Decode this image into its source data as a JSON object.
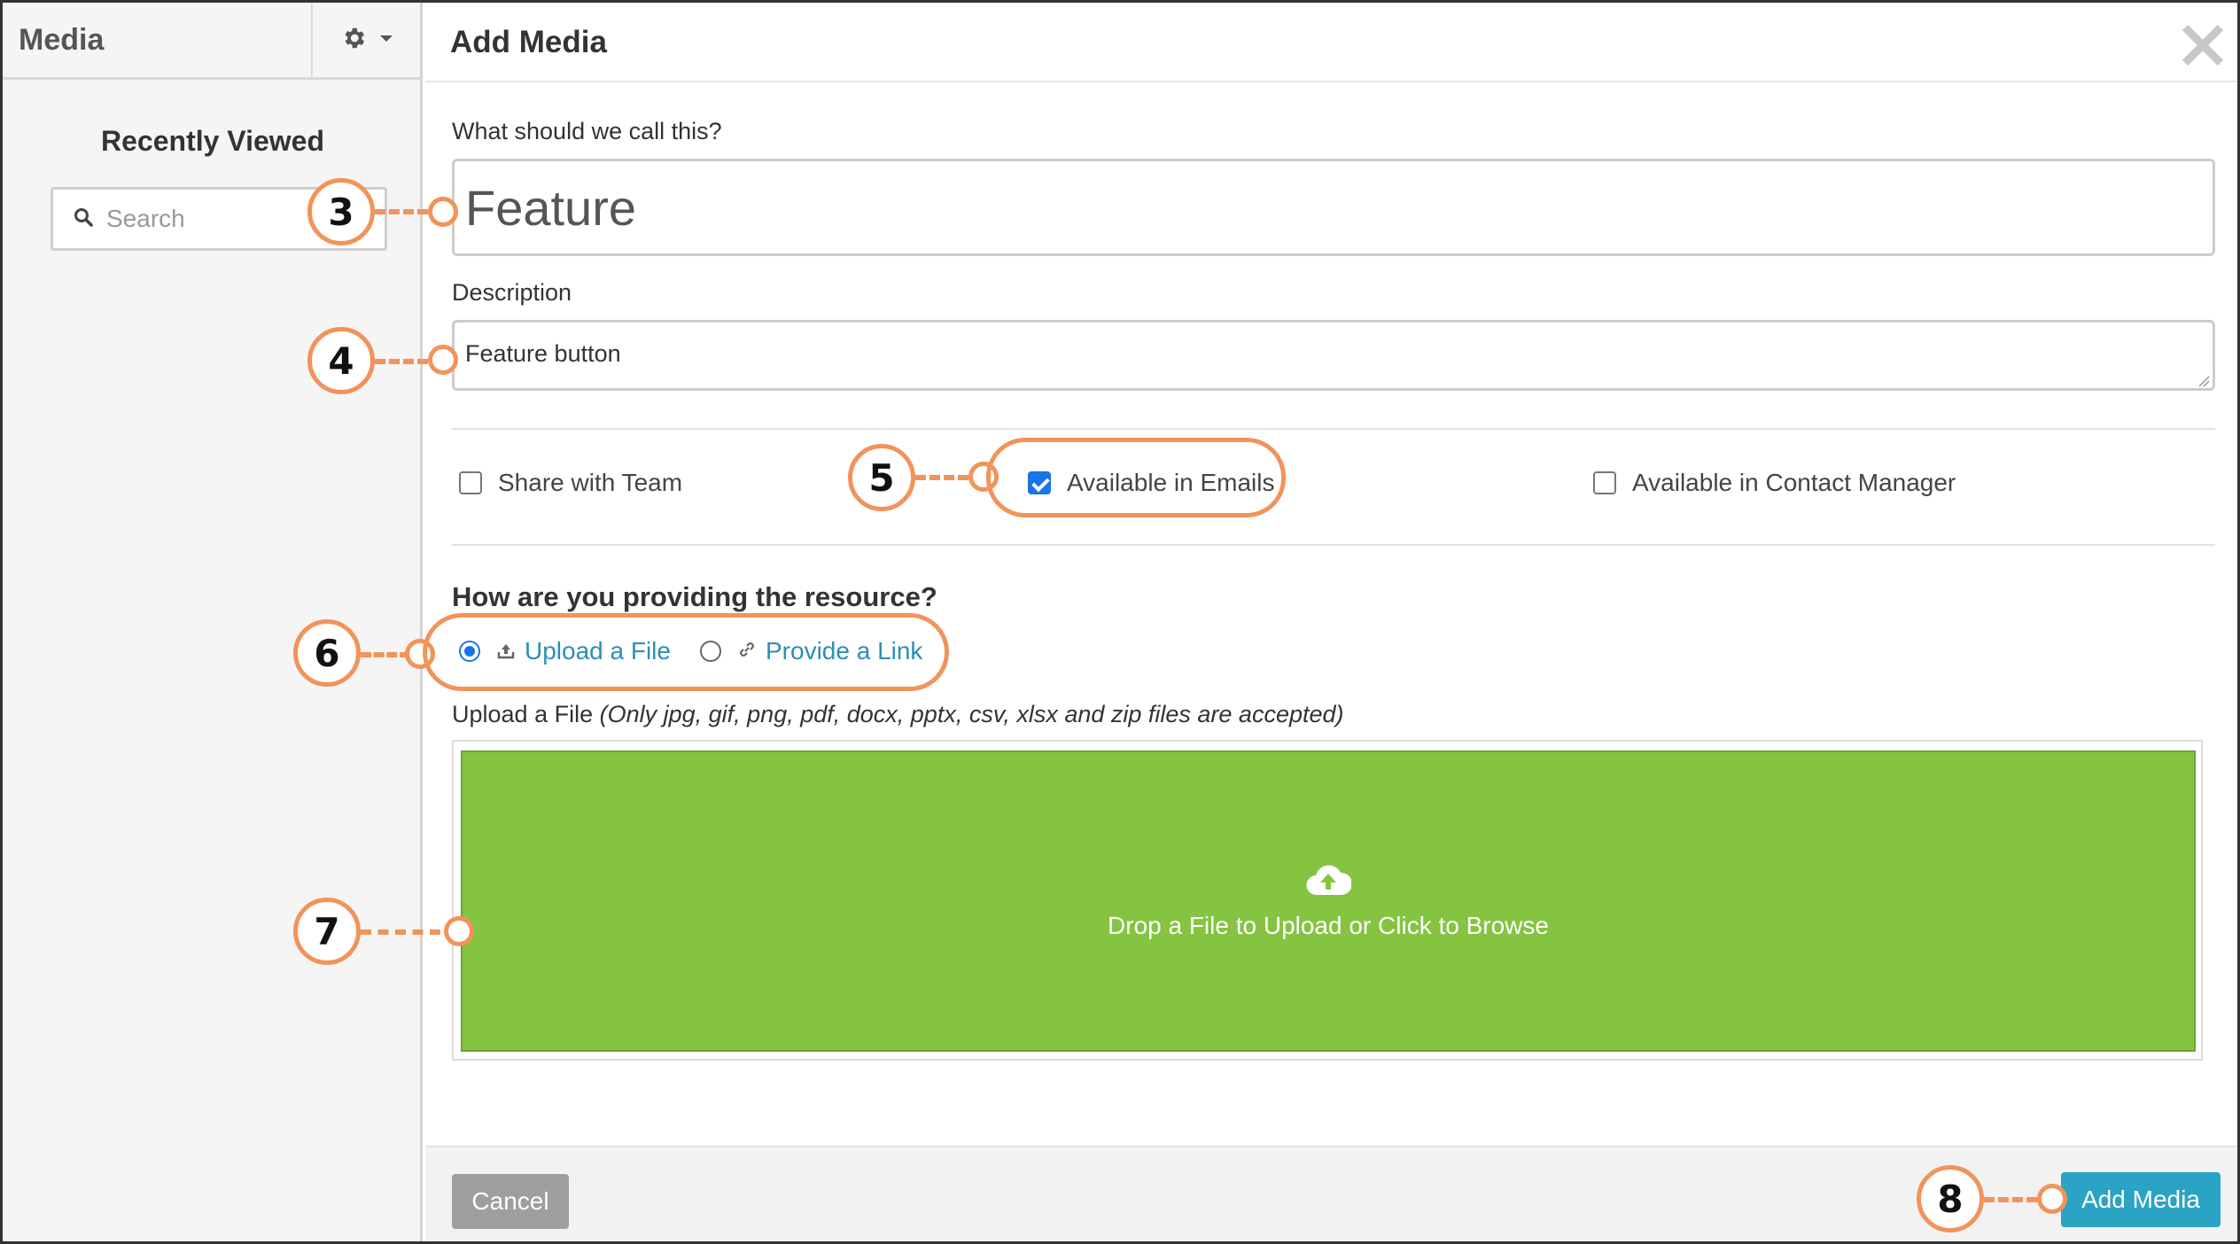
{
  "sidebar": {
    "title": "Media",
    "recently_viewed": "Recently Viewed",
    "search_placeholder": "Search"
  },
  "dialog": {
    "title": "Add Media",
    "name_label": "What should we call this?",
    "name_value": "Feature",
    "description_label": "Description",
    "description_value": "Feature button",
    "checkboxes": [
      {
        "label": "Share with Team",
        "checked": false
      },
      {
        "label": "Available in Emails",
        "checked": true
      },
      {
        "label": "Available in Contact Manager",
        "checked": false
      }
    ],
    "resource_question": "How are you providing the resource?",
    "radio_options": [
      {
        "label": "Upload a File",
        "selected": true
      },
      {
        "label": "Provide a Link",
        "selected": false
      }
    ],
    "upload_label": "Upload a File",
    "upload_note": "(Only jpg, gif, png, pdf, docx, pptx, csv, xlsx and zip files are accepted)",
    "dropzone_text": "Drop a File to Upload or Click to Browse",
    "cancel_label": "Cancel",
    "add_label": "Add Media"
  },
  "callouts": [
    "3",
    "4",
    "5",
    "6",
    "7",
    "8"
  ],
  "colors": {
    "accent_orange": "#f2935a",
    "dropzone_green": "#84c441",
    "primary_button": "#2aa3c4",
    "link": "#2b8fb5"
  }
}
